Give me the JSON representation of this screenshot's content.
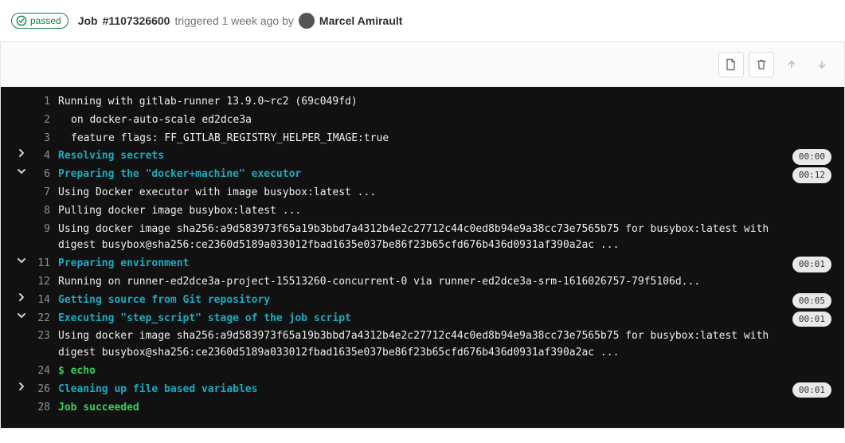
{
  "header": {
    "status_label": "passed",
    "job_label_prefix": "Job",
    "job_id": "#1107326600",
    "triggered_text": "triggered 1 week ago by",
    "author": "Marcel Amirault"
  },
  "toolbar": {
    "raw_icon": "document",
    "delete_icon": "trash",
    "scroll_up_icon": "arrow-up",
    "scroll_down_icon": "arrow-down"
  },
  "log": [
    {
      "n": 1,
      "kind": "plain",
      "text": "Running with gitlab-runner 13.9.0~rc2 (69c049fd)"
    },
    {
      "n": 2,
      "kind": "plain",
      "indent": true,
      "text": "on docker-auto-scale ed2dce3a"
    },
    {
      "n": 3,
      "kind": "plain",
      "indent": true,
      "text": "feature flags: FF_GITLAB_REGISTRY_HELPER_IMAGE:true"
    },
    {
      "n": 4,
      "kind": "section",
      "state": "collapsed",
      "text": "Resolving secrets",
      "duration": "00:00"
    },
    {
      "n": 6,
      "kind": "section",
      "state": "expanded",
      "text": "Preparing the \"docker+machine\" executor",
      "duration": "00:12"
    },
    {
      "n": 7,
      "kind": "plain",
      "text": "Using Docker executor with image busybox:latest ..."
    },
    {
      "n": 8,
      "kind": "plain",
      "text": "Pulling docker image busybox:latest ..."
    },
    {
      "n": 9,
      "kind": "plain",
      "text": "Using docker image sha256:a9d583973f65a19b3bbd7a4312b4e2c27712c44c0ed8b94e9a38cc73e7565b75 for busybox:latest with digest busybox@sha256:ce2360d5189a033012fbad1635e037be86f23b65cfd676b436d0931af390a2ac ..."
    },
    {
      "n": 11,
      "kind": "section",
      "state": "expanded",
      "text": "Preparing environment",
      "duration": "00:01"
    },
    {
      "n": 12,
      "kind": "plain",
      "text": "Running on runner-ed2dce3a-project-15513260-concurrent-0 via runner-ed2dce3a-srm-1616026757-79f5106d..."
    },
    {
      "n": 14,
      "kind": "section",
      "state": "collapsed",
      "text": "Getting source from Git repository",
      "duration": "00:05"
    },
    {
      "n": 22,
      "kind": "section",
      "state": "expanded",
      "text": "Executing \"step_script\" stage of the job script",
      "duration": "00:01"
    },
    {
      "n": 23,
      "kind": "plain",
      "text": "Using docker image sha256:a9d583973f65a19b3bbd7a4312b4e2c27712c44c0ed8b94e9a38cc73e7565b75 for busybox:latest with digest busybox@sha256:ce2360d5189a033012fbad1635e037be86f23b65cfd676b436d0931af390a2ac ..."
    },
    {
      "n": 24,
      "kind": "cmd",
      "text": "$ echo"
    },
    {
      "n": 26,
      "kind": "section",
      "state": "collapsed",
      "text": "Cleaning up file based variables",
      "duration": "00:01"
    },
    {
      "n": 28,
      "kind": "success",
      "text": "Job succeeded"
    }
  ]
}
